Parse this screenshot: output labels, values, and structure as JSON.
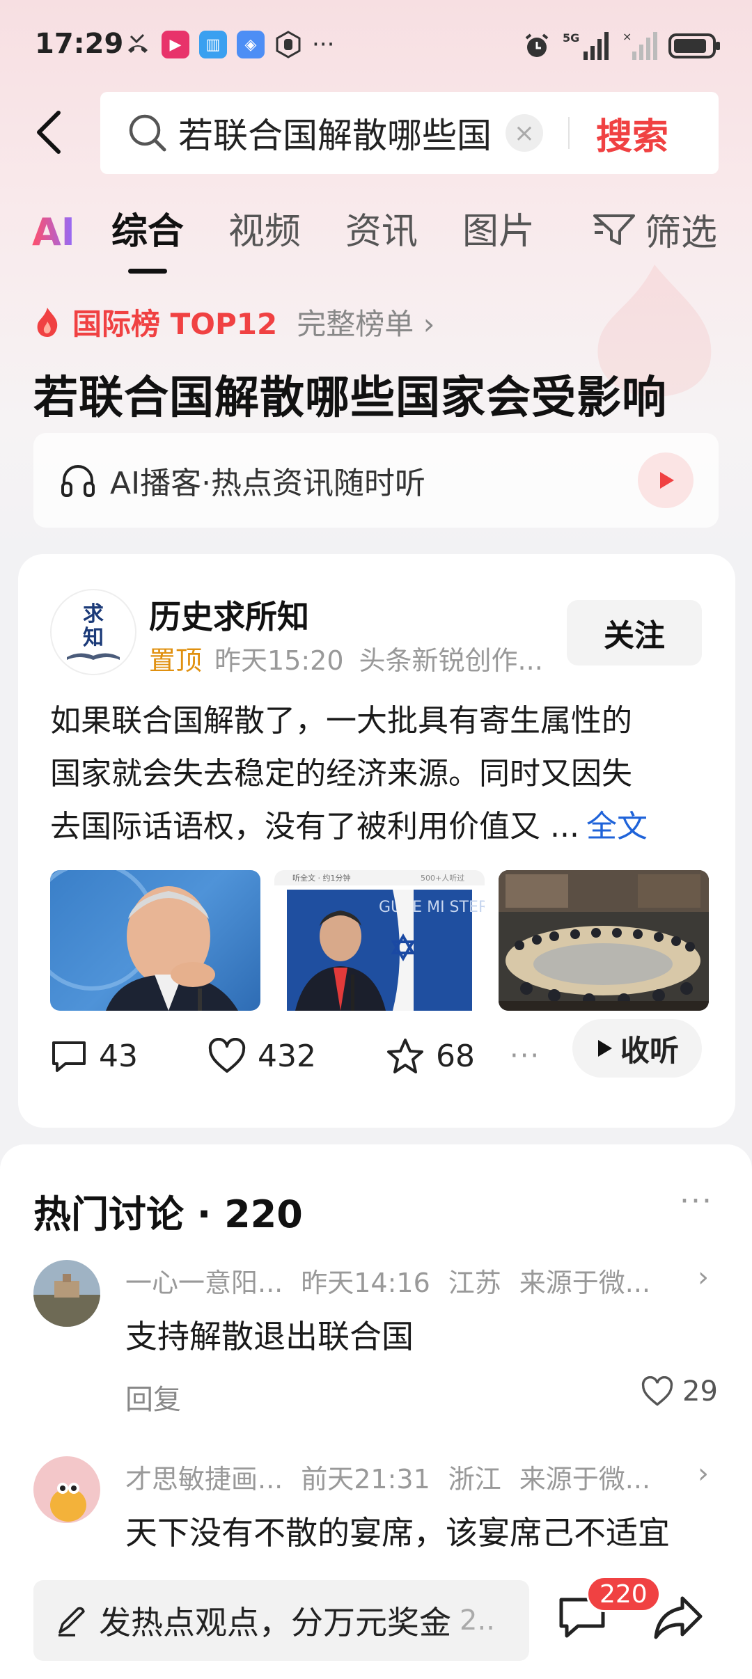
{
  "status_bar": {
    "time": "17:29",
    "network": "5G",
    "icons": [
      "missed-call-icon",
      "video-app-icon",
      "book-app-icon",
      "shield-app-icon",
      "hand-icon",
      "more-dots-icon",
      "alarm-icon",
      "signal-icon",
      "battery-icon"
    ]
  },
  "search": {
    "query": "若联合国解散哪些国",
    "button_label": "搜索"
  },
  "tabs": [
    {
      "label": "AI"
    },
    {
      "label": "综合",
      "active": true
    },
    {
      "label": "视频"
    },
    {
      "label": "资讯"
    },
    {
      "label": "图片"
    }
  ],
  "filter_label": "筛选",
  "hot_rank": {
    "label": "国际榜 TOP12",
    "full_list_label": "完整榜单 ›"
  },
  "headline": "若联合国解散哪些国家会受影响",
  "podcast": {
    "label": "AI播客·热点资讯随时听"
  },
  "post": {
    "author": "历史求所知",
    "avatar_text": [
      "求",
      "知"
    ],
    "pinned_label": "置顶",
    "time": "昨天15:20",
    "source": "头条新锐创作...",
    "follow_label": "关注",
    "body_lines": [
      "如果联合国解散了，一大批具有寄生属性的",
      "国家就会失去稳定的经济来源。同时又因失",
      "去国际话语权，没有了被利用价值又 ..."
    ],
    "more_label": "全文",
    "image2_caption_left": "听全文 · 约1分钟",
    "image2_caption_right": "500+人听过",
    "image2_sign": "GUVE MI STERU",
    "comments_count": "43",
    "likes_count": "432",
    "favorites_count": "68",
    "listen_label": "收听"
  },
  "discussion": {
    "title": "热门讨论 · 220",
    "comments": [
      {
        "user": "一心一意阳...",
        "time": "昨天14:16",
        "location": "江苏",
        "source": "来源于微...",
        "text": "支持解散退出联合国",
        "reply_label": "回复",
        "likes": "29"
      },
      {
        "user": "才思敏捷画...",
        "time": "前天21:31",
        "location": "浙江",
        "source": "来源于微...",
        "text": "天下没有不散的宴席，该宴席己不适宜"
      }
    ]
  },
  "bottom_bar": {
    "composer_label": "发热点观点，分万元奖金",
    "composer_suffix": "2..",
    "comment_badge": "220"
  },
  "colors": {
    "accent_red": "#f04142",
    "link_blue": "#1f63d9",
    "pin_orange": "#e0900f"
  }
}
